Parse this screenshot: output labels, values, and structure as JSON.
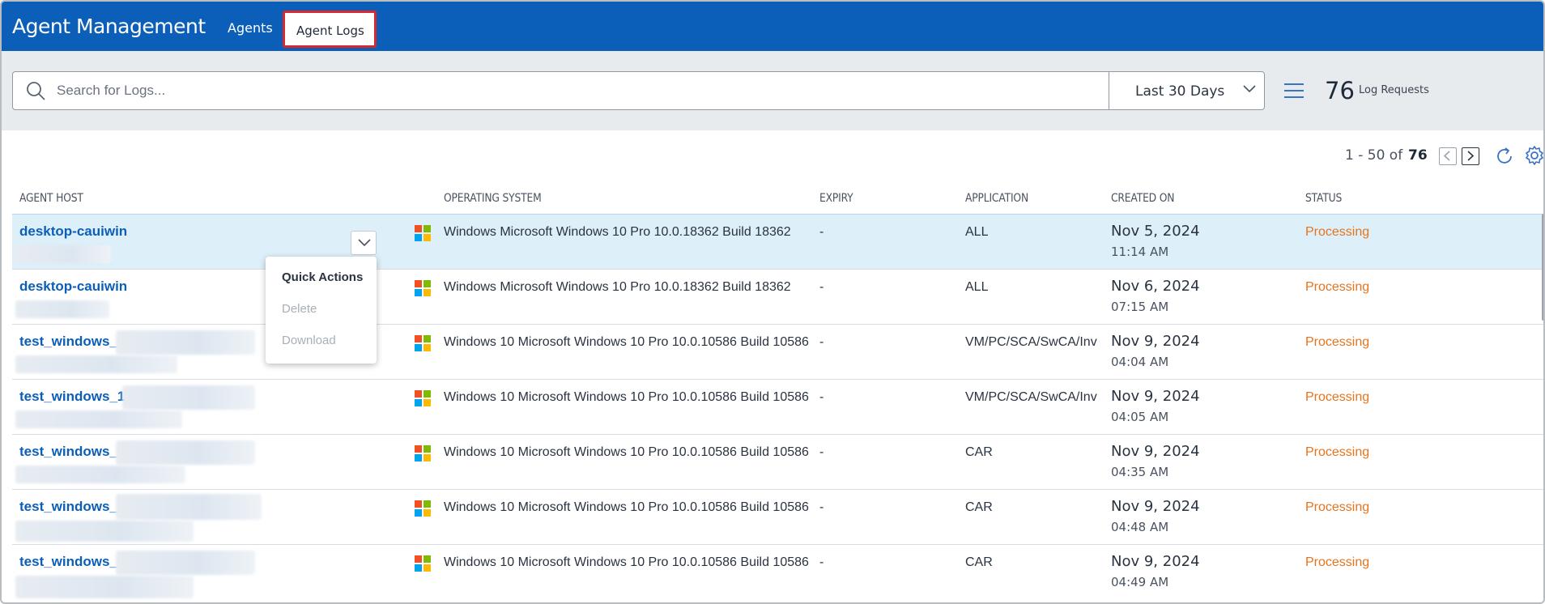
{
  "header": {
    "app_title": "Agent Management",
    "tabs": [
      {
        "label": "Agents",
        "active": false
      },
      {
        "label": "Agent Logs",
        "active": true
      }
    ]
  },
  "toolbar": {
    "search_placeholder": "Search for Logs...",
    "date_range": "Last 30 Days",
    "log_count": "76",
    "log_count_label": "Log Requests"
  },
  "pagination": {
    "range": "1 - 50 of",
    "total": "76"
  },
  "table": {
    "columns": [
      "Agent Host",
      "Operating System",
      "Expiry",
      "Application",
      "Created On",
      "Status"
    ],
    "rows": [
      {
        "host": "desktop-cauiwin",
        "os": "Windows Microsoft Windows 10 Pro 10.0.18362 Build 18362",
        "expiry": "-",
        "application": "ALL",
        "date": "Nov 5, 2024",
        "time": "11:14 AM",
        "status": "Processing"
      },
      {
        "host": "desktop-cauiwin",
        "os": "Windows Microsoft Windows 10 Pro 10.0.18362 Build 18362",
        "expiry": "-",
        "application": "ALL",
        "date": "Nov 6, 2024",
        "time": "07:15 AM",
        "status": "Processing"
      },
      {
        "host": "test_windows_",
        "os": "Windows 10 Microsoft Windows 10 Pro 10.0.10586 Build 10586",
        "expiry": "-",
        "application": "VM/PC/SCA/SwCA/Inve",
        "date": "Nov 9, 2024",
        "time": "04:04 AM",
        "status": "Processing"
      },
      {
        "host": "test_windows_1",
        "os": "Windows 10 Microsoft Windows 10 Pro 10.0.10586 Build 10586",
        "expiry": "-",
        "application": "VM/PC/SCA/SwCA/Inve",
        "date": "Nov 9, 2024",
        "time": "04:05 AM",
        "status": "Processing"
      },
      {
        "host": "test_windows_",
        "os": "Windows 10 Microsoft Windows 10 Pro 10.0.10586 Build 10586",
        "expiry": "-",
        "application": "CAR",
        "date": "Nov 9, 2024",
        "time": "04:35 AM",
        "status": "Processing"
      },
      {
        "host": "test_windows_",
        "os": "Windows 10 Microsoft Windows 10 Pro 10.0.10586 Build 10586",
        "expiry": "-",
        "application": "CAR",
        "date": "Nov 9, 2024",
        "time": "04:48 AM",
        "status": "Processing"
      },
      {
        "host": "test_windows_",
        "os": "Windows 10 Microsoft Windows 10 Pro 10.0.10586 Build 10586",
        "expiry": "-",
        "application": "CAR",
        "date": "Nov 9, 2024",
        "time": "04:49 AM",
        "status": "Processing"
      }
    ]
  },
  "quick_actions": {
    "title": "Quick Actions",
    "items": [
      "Delete",
      "Download"
    ]
  },
  "colors": {
    "header_bg": "#0b5fb8",
    "status_processing": "#e5741d",
    "link": "#0b5fb8",
    "selected_row": "#ddeff9"
  },
  "icons": [
    "search-icon",
    "chevron-down-icon",
    "menu-icon",
    "chevron-left-icon",
    "chevron-right-icon",
    "refresh-icon",
    "gear-icon",
    "windows-logo-icon"
  ]
}
